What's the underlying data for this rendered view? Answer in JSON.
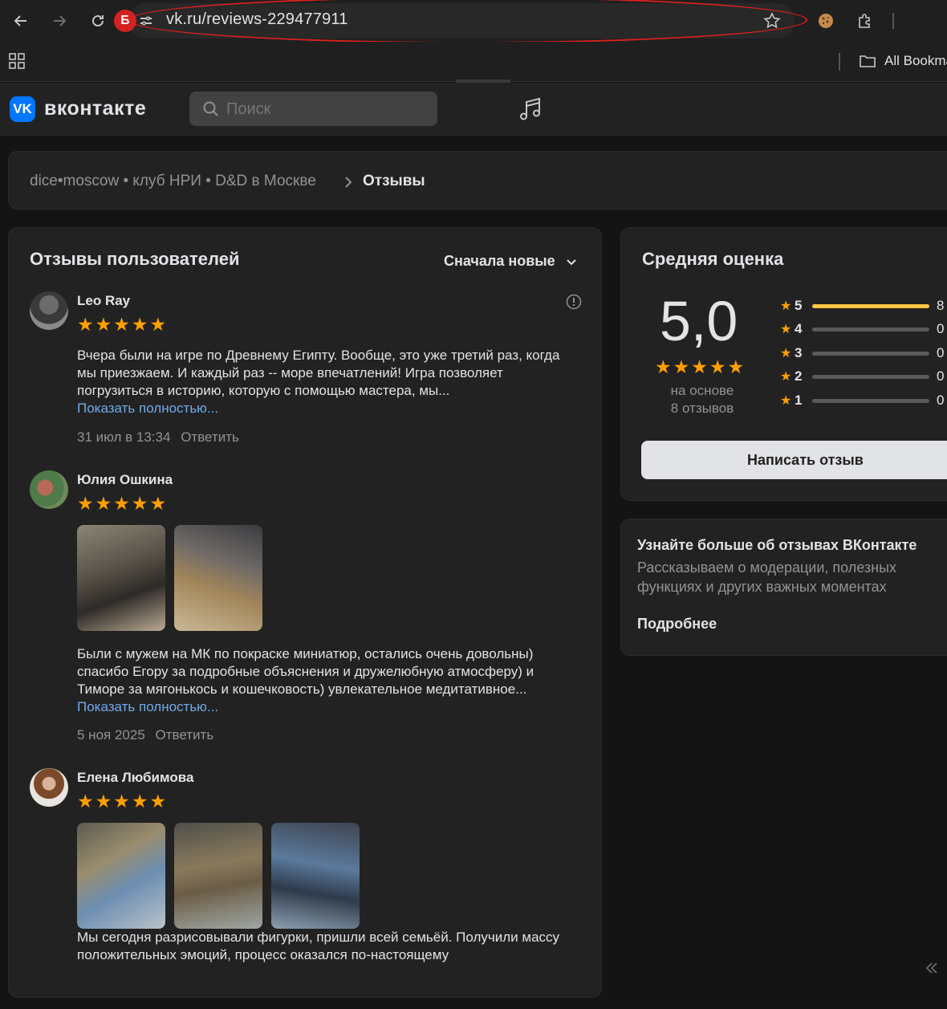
{
  "browser": {
    "url": "vk.ru/reviews-229477911",
    "profile_badge": "Б",
    "bookmark_folder": "All Bookma"
  },
  "vk": {
    "logo_text": "вконтакте",
    "logo_mark": "VK",
    "search_placeholder": "Поиск"
  },
  "breadcrumb": {
    "community": "dice•moscow • клуб НРИ • D&D в Москве",
    "current": "Отзывы"
  },
  "reviews_panel": {
    "title": "Отзывы пользователей",
    "sort_label": "Сначала новые",
    "reviews": [
      {
        "author": "Leo Ray",
        "rating": 5,
        "text": "Вчера были на игре по Древнему Египту. Вообще, это уже третий раз, когда мы приезжаем. И каждый раз -- море впечатлений! Игра позволяет погрузиться в историю, которую с помощью мастера, мы...",
        "more": "Показать полностью...",
        "date": "31 июл в 13:34",
        "reply": "Ответить"
      },
      {
        "author": "Юлия Ошкина",
        "rating": 5,
        "text": "Были с мужем на МК по покраске миниатюр, остались очень довольны) спасибо Егору за подробные объяснения и дружелюбную атмосферу) и Тиморе за мягонькось и кошечковость) увлекательное медитативное...",
        "more": "Показать полностью...",
        "date": "5 ноя 2025",
        "reply": "Ответить"
      },
      {
        "author": "Елена Любимова",
        "rating": 5,
        "text": "Мы сегодня разрисовывали фигурки, пришли всей семьёй. Получили массу положительных эмоций, процесс оказался по-настоящему"
      }
    ]
  },
  "rating_panel": {
    "title": "Средняя оценка",
    "average": "5,0",
    "based_on_line1": "на основе",
    "based_on_line2": "8 отзывов",
    "distribution": [
      {
        "stars": "5",
        "count": "8",
        "fraction": 1.0
      },
      {
        "stars": "4",
        "count": "0",
        "fraction": 0
      },
      {
        "stars": "3",
        "count": "0",
        "fraction": 0
      },
      {
        "stars": "2",
        "count": "0",
        "fraction": 0
      },
      {
        "stars": "1",
        "count": "0",
        "fraction": 0
      }
    ],
    "write_button": "Написать отзыв"
  },
  "learn_panel": {
    "title": "Узнайте больше об отзывах ВКонтакте",
    "text": "Рассказываем о модерации, полезных функциях и других важных моментах",
    "link": "Подробнее"
  },
  "colors": {
    "accent_link": "#71aaeb",
    "star": "#ffa000",
    "bar_fill": "#ffc543",
    "vk_blue": "#0077ff"
  }
}
